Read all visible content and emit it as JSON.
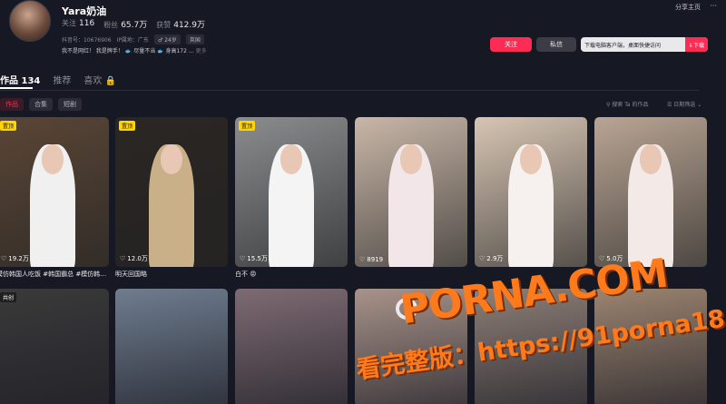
{
  "profile": {
    "name": "Yara奶油",
    "follow_label": "关注",
    "follow_count": "116",
    "fans_label": "粉丝",
    "fans_count": "65.7万",
    "likes_label": "获赞",
    "likes_count": "412.9万",
    "douyin_id": "抖音号：10676906",
    "ip": "IP属地：广东",
    "age_tag": "24岁",
    "region_tag": "英国",
    "bio": "我不是网红！ 我是牌手！ 🐟 尽量不当 🐟 身高172 ...",
    "bio_more": "更多"
  },
  "top_actions": {
    "share": "分享主页",
    "more": "···"
  },
  "buttons": {
    "follow": "关注",
    "message": "私信",
    "download_hint": "下载电脑客户端，桌面快捷访问",
    "download": "⇩下载"
  },
  "tabs": [
    {
      "label": "作品 134"
    },
    {
      "label": "推荐"
    },
    {
      "label": "喜欢 🔒"
    }
  ],
  "subtabs": [
    {
      "label": "作品"
    },
    {
      "label": "合集"
    },
    {
      "label": "短剧"
    }
  ],
  "search_works": "⚲ 搜索 Ta 的作品",
  "sort": "☰ 日期筛选 ⌄",
  "videos": [
    {
      "pinned": "置顶",
      "likes": "19.2万",
      "caption": "模仿韩国人吃饭 #韩国霸总 #模仿韩…",
      "bg": "#5a4636",
      "fig": "#f0f0f0"
    },
    {
      "pinned": "置顶",
      "likes": "12.0万",
      "caption": "明天回国略",
      "bg": "#2a2623",
      "fig": "#c9b089"
    },
    {
      "pinned": "置顶",
      "likes": "15.5万",
      "caption": "白不 😡",
      "bg": "#8a8c8e",
      "fig": "#f4f4f4"
    },
    {
      "pinned": "",
      "likes": "8919",
      "caption": "",
      "bg": "#c9b7a8",
      "fig": "#f2e6e8"
    },
    {
      "pinned": "",
      "likes": "2.9万",
      "caption": "",
      "bg": "#d7c5b3",
      "fig": "#f6f1ee"
    },
    {
      "pinned": "",
      "likes": "5.0万",
      "caption": "",
      "bg": "#b9a594",
      "fig": "#f3e9e6"
    }
  ],
  "row2": [
    {
      "badge": "共创",
      "bg": "#3a3a3a"
    },
    {
      "badge": "",
      "bg": "#6f7d8f"
    },
    {
      "badge": "",
      "bg": "#7e6b73"
    },
    {
      "badge": "",
      "bg": "#a8938a"
    },
    {
      "badge": "",
      "bg": "#8e7f77"
    },
    {
      "badge": "",
      "bg": "#9c8470"
    }
  ],
  "watermark": {
    "line1": "PORNA.COM",
    "line2": "看完整版：https://91porna18.com"
  }
}
